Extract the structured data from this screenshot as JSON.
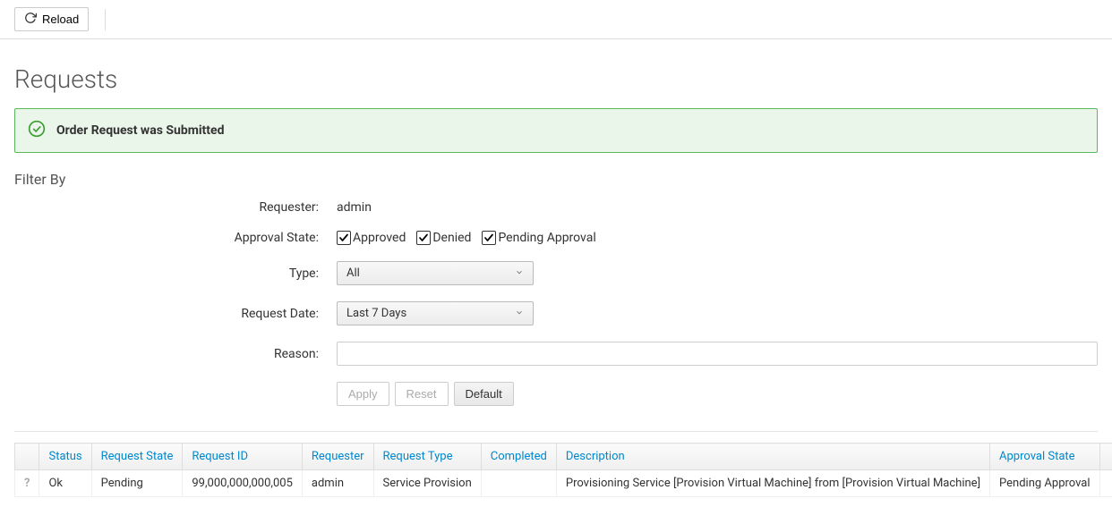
{
  "toolbar": {
    "reload_label": "Reload"
  },
  "page_title": "Requests",
  "alert_message": "Order Request was Submitted",
  "filter": {
    "section_title": "Filter By",
    "labels": {
      "requester": "Requester:",
      "approval_state": "Approval State:",
      "type": "Type:",
      "request_date": "Request Date:",
      "reason": "Reason:"
    },
    "requester_value": "admin",
    "approval_states": {
      "approved": "Approved",
      "denied": "Denied",
      "pending": "Pending Approval"
    },
    "type_selected": "All",
    "request_date_selected": "Last 7 Days",
    "reason_value": "",
    "buttons": {
      "apply": "Apply",
      "reset": "Reset",
      "default": "Default"
    }
  },
  "table": {
    "headers": {
      "status": "Status",
      "request_state": "Request State",
      "request_id": "Request ID",
      "requester": "Requester",
      "request_type": "Request Type",
      "completed": "Completed",
      "description": "Description",
      "approval_state": "Approval State"
    },
    "rows": [
      {
        "icon": "?",
        "status": "Ok",
        "request_state": "Pending",
        "request_id": "99,000,000,000,005",
        "requester": "admin",
        "request_type": "Service Provision",
        "completed": "",
        "description": "Provisioning Service [Provision Virtual Machine] from [Provision Virtual Machine]",
        "approval_state": "Pending Approval"
      }
    ]
  }
}
